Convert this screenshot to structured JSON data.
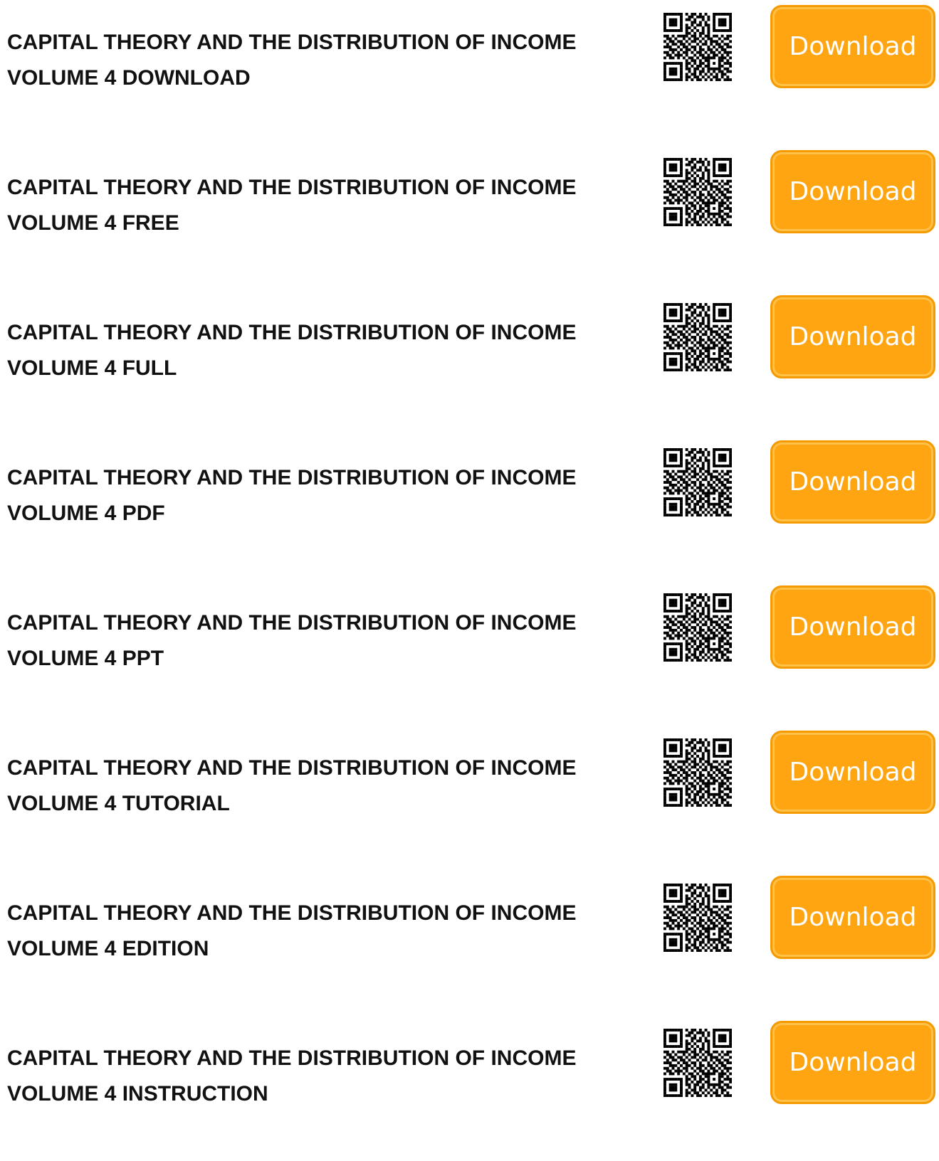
{
  "button_label": "Download",
  "qr_icon": "qr-code-icon",
  "colors": {
    "button_bg": "#ffa512",
    "button_border": "#f59a00",
    "title_text": "#111111"
  },
  "items": [
    {
      "line1": "CAPITAL THEORY AND THE DISTRIBUTION OF INCOME",
      "line2": "VOLUME 4 DOWNLOAD"
    },
    {
      "line1": "CAPITAL THEORY AND THE DISTRIBUTION OF INCOME",
      "line2": "VOLUME 4 FREE"
    },
    {
      "line1": "CAPITAL THEORY AND THE DISTRIBUTION OF INCOME",
      "line2": "VOLUME 4 FULL"
    },
    {
      "line1": "CAPITAL THEORY AND THE DISTRIBUTION OF INCOME",
      "line2": "VOLUME 4 PDF"
    },
    {
      "line1": "CAPITAL THEORY AND THE DISTRIBUTION OF INCOME",
      "line2": "VOLUME 4 PPT"
    },
    {
      "line1": "CAPITAL THEORY AND THE DISTRIBUTION OF INCOME",
      "line2": "VOLUME 4 TUTORIAL"
    },
    {
      "line1": "CAPITAL THEORY AND THE DISTRIBUTION OF INCOME",
      "line2": "VOLUME 4 EDITION"
    },
    {
      "line1": "CAPITAL THEORY AND THE DISTRIBUTION OF INCOME",
      "line2": "VOLUME 4 INSTRUCTION"
    }
  ]
}
